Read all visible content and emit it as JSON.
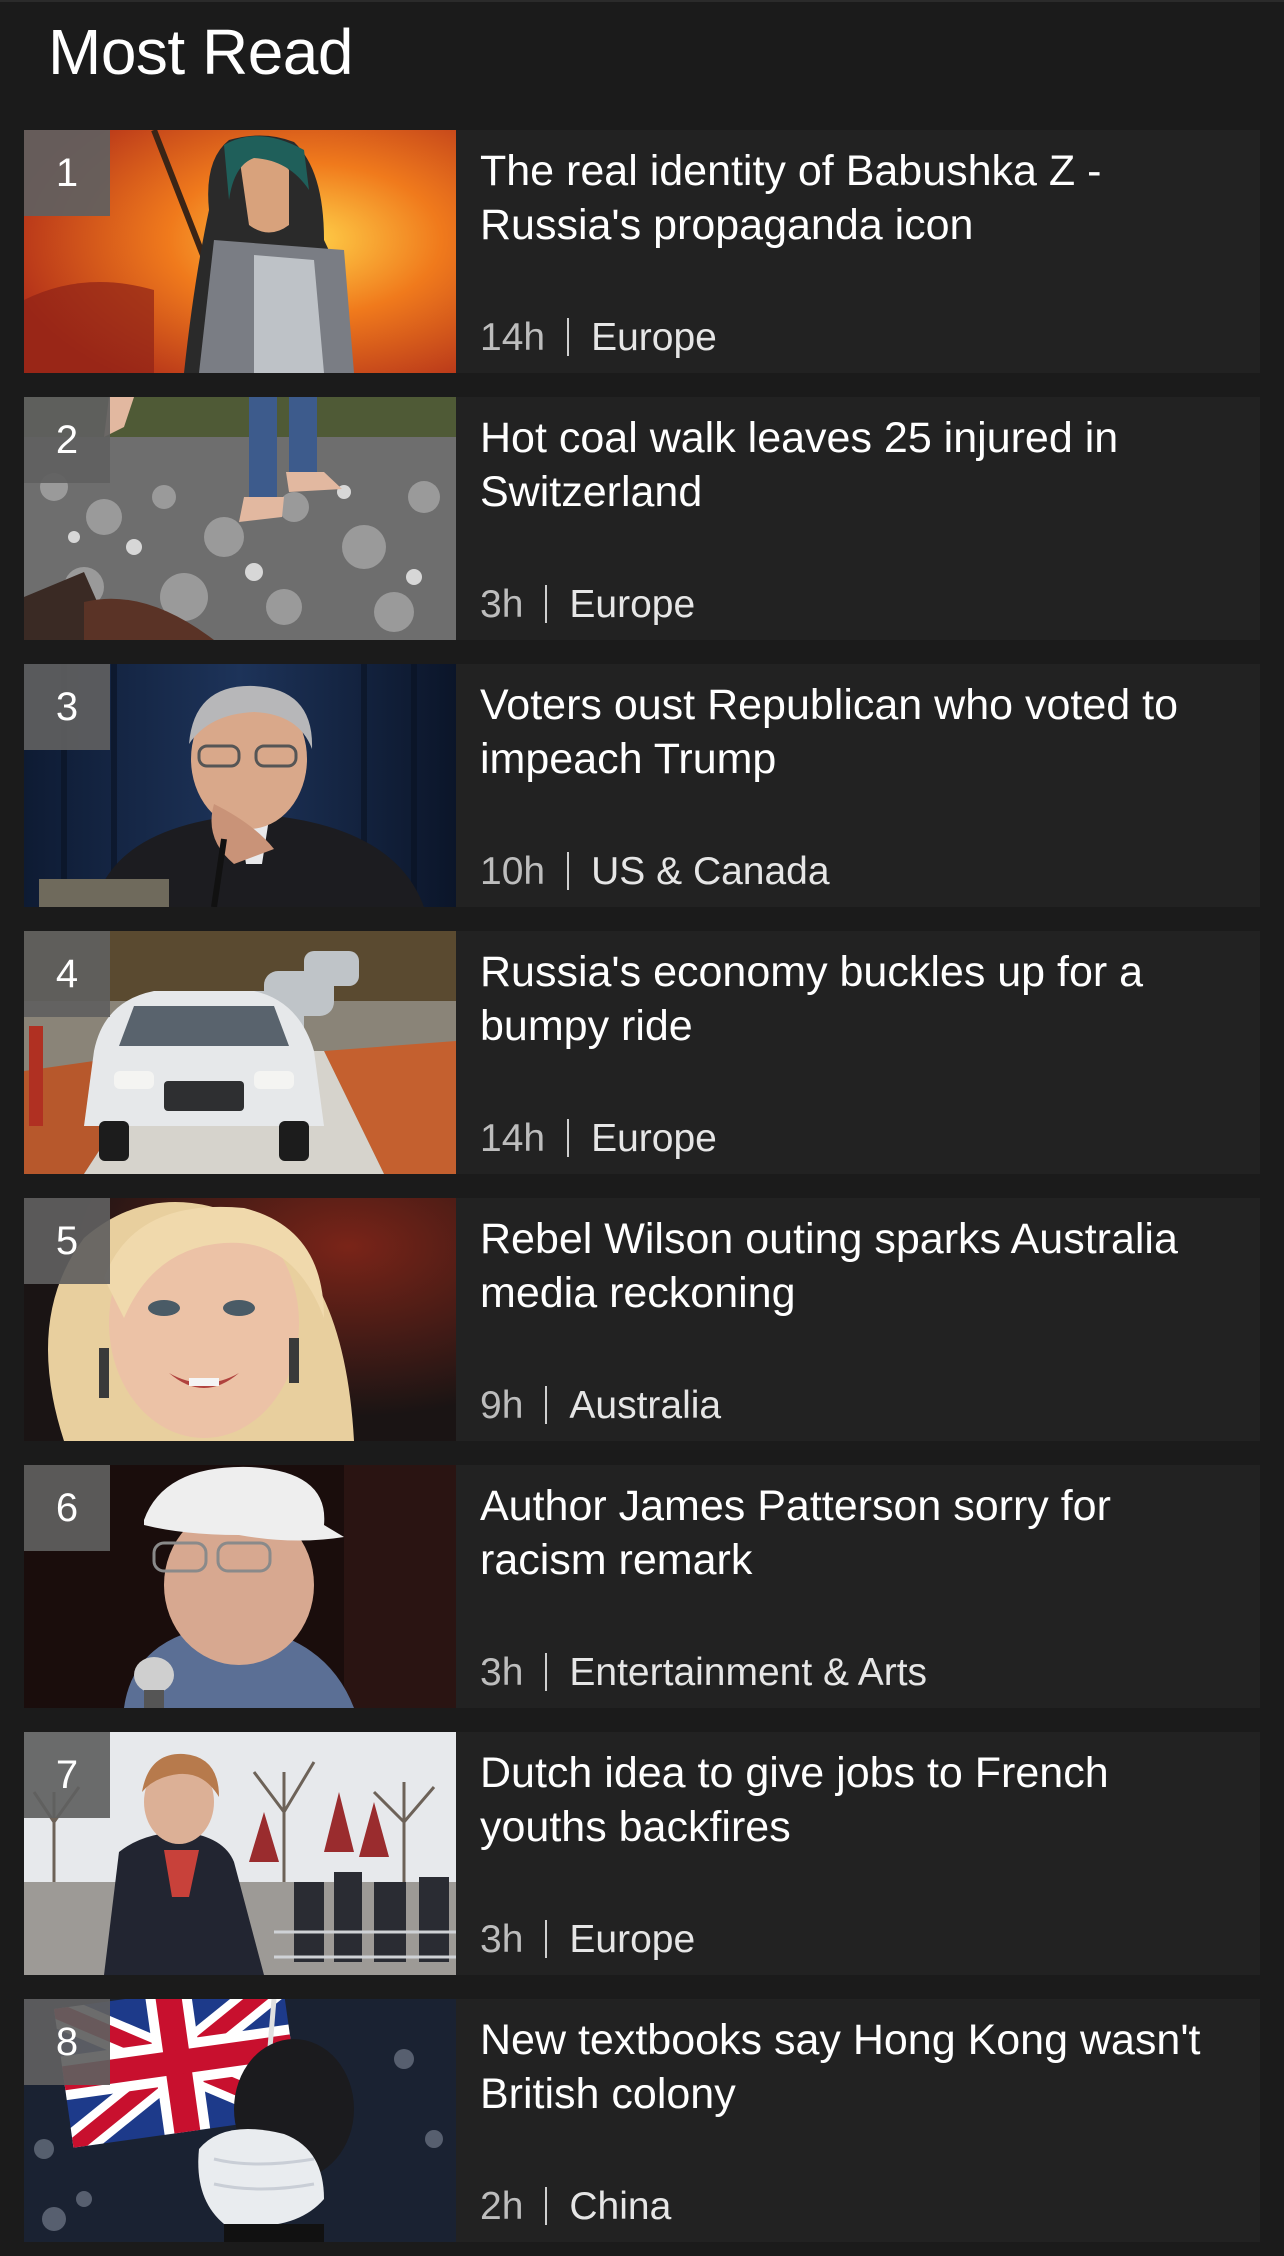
{
  "section": {
    "title": "Most Read"
  },
  "items": [
    {
      "rank": "1",
      "headline": "The real identity of Babushka Z - Russia's propaganda icon",
      "time": "14h",
      "category": "Europe",
      "thumb_icon": "babushka-illustration-image"
    },
    {
      "rank": "2",
      "headline": "Hot coal walk leaves 25 injured in Switzerland",
      "time": "3h",
      "category": "Europe",
      "thumb_icon": "coal-walk-photo"
    },
    {
      "rank": "3",
      "headline": "Voters oust Republican who voted to impeach Trump",
      "time": "10h",
      "category": "US & Canada",
      "thumb_icon": "politician-photo"
    },
    {
      "rank": "4",
      "headline": "Russia's economy buckles up for a bumpy ride",
      "time": "14h",
      "category": "Europe",
      "thumb_icon": "car-factory-photo"
    },
    {
      "rank": "5",
      "headline": "Rebel Wilson outing sparks Australia media reckoning",
      "time": "9h",
      "category": "Australia",
      "thumb_icon": "portrait-photo"
    },
    {
      "rank": "6",
      "headline": "Author James Patterson sorry for racism remark",
      "time": "3h",
      "category": "Entertainment & Arts",
      "thumb_icon": "author-photo"
    },
    {
      "rank": "7",
      "headline": "Dutch idea to give jobs to French youths backfires",
      "time": "3h",
      "category": "Europe",
      "thumb_icon": "street-press-photo"
    },
    {
      "rank": "8",
      "headline": "New textbooks say Hong Kong wasn't British colony",
      "time": "2h",
      "category": "China",
      "thumb_icon": "union-flag-protest-photo"
    }
  ],
  "colors": {
    "background": "#1b1b1b",
    "card": "#222222",
    "rank_badge": "#5f5f5f",
    "headline": "#ffffff",
    "meta": "#bdbdbd"
  }
}
